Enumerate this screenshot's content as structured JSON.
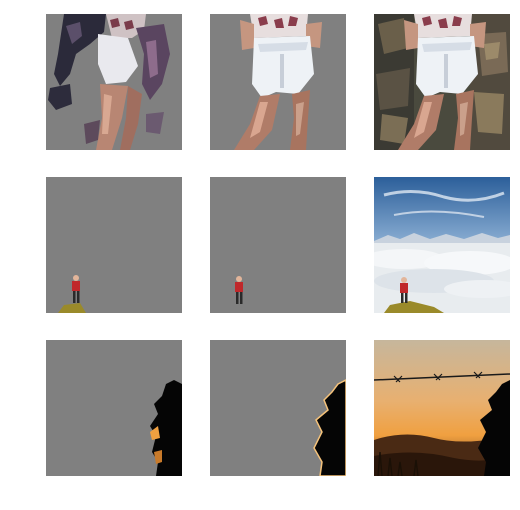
{
  "grid": {
    "rows": [
      {
        "subject": "woman-in-shorts",
        "tiles": [
          {
            "kind": "mask-prediction-1",
            "background": "#808080"
          },
          {
            "kind": "mask-prediction-2",
            "background": "#808080"
          },
          {
            "kind": "original-photo"
          }
        ]
      },
      {
        "subject": "hiker-above-clouds",
        "tiles": [
          {
            "kind": "mask-prediction-1",
            "background": "#808080"
          },
          {
            "kind": "mask-prediction-2",
            "background": "#808080"
          },
          {
            "kind": "original-photo"
          }
        ]
      },
      {
        "subject": "silhouette-at-sunset",
        "tiles": [
          {
            "kind": "mask-prediction-1",
            "background": "#808080"
          },
          {
            "kind": "mask-prediction-2",
            "background": "#808080"
          },
          {
            "kind": "original-photo"
          }
        ]
      }
    ]
  },
  "colors": {
    "mask_gray": "#808080",
    "sky_blue": "#3f6fa6",
    "cloud_white": "#e8ecef",
    "jacket_red": "#c0282b",
    "sunset_orange": "#f0a040",
    "silhouette": "#050505"
  }
}
